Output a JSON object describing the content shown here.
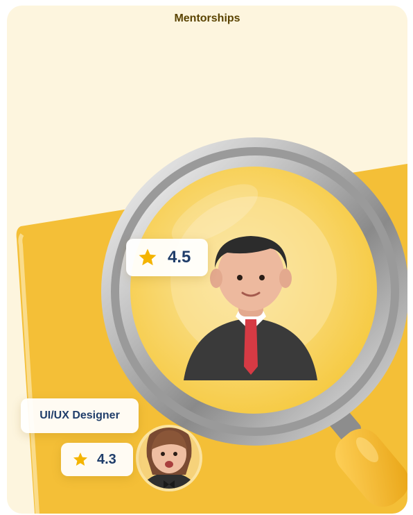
{
  "header": {
    "title": "Mentorships"
  },
  "main_mentor": {
    "rating": "4.5"
  },
  "secondary_mentor": {
    "role": "UI/UX Designer",
    "rating": "4.3"
  },
  "colors": {
    "background": "#fdf5de",
    "accent": "#f4bf37",
    "title": "#5a4300",
    "rating_text": "#1f3d6a",
    "star": "#f4b400"
  },
  "icons": {
    "rating_icon": "star-icon",
    "search_icon": "magnifying-glass-icon"
  }
}
